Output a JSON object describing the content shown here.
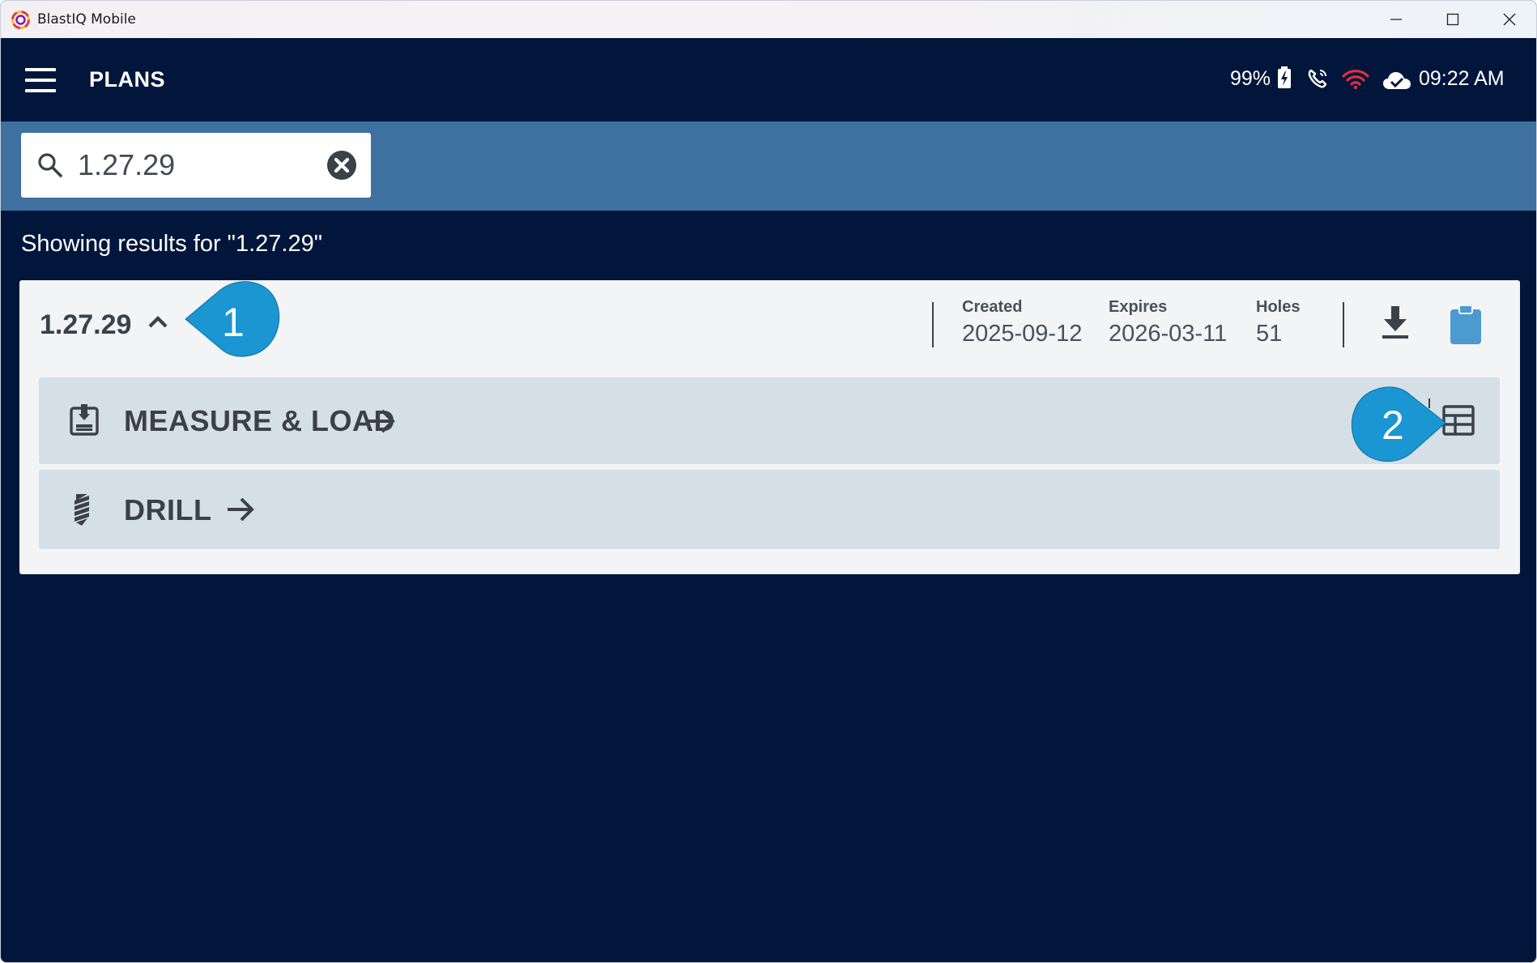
{
  "window": {
    "title": "BlastIQ Mobile"
  },
  "appbar": {
    "title": "PLANS",
    "battery": "99%",
    "time": "09:22 AM"
  },
  "search": {
    "value": "1.27.29",
    "placeholder": ""
  },
  "results": {
    "text": "Showing results for \"1.27.29\""
  },
  "plan": {
    "name": "1.27.29",
    "created_label": "Created",
    "created_value": "2025-09-12",
    "expires_label": "Expires",
    "expires_value": "2026-03-11",
    "holes_label": "Holes",
    "holes_value": "51",
    "workflows": [
      {
        "label": "MEASURE & LOAD"
      },
      {
        "label": "DRILL"
      }
    ]
  },
  "callouts": [
    "1",
    "2"
  ],
  "colors": {
    "background": "#02163c",
    "search_band": "#3f71a0",
    "callout": "#1a96d2",
    "wifi": "#d9333f",
    "clipboard": "#4b9bd0"
  }
}
